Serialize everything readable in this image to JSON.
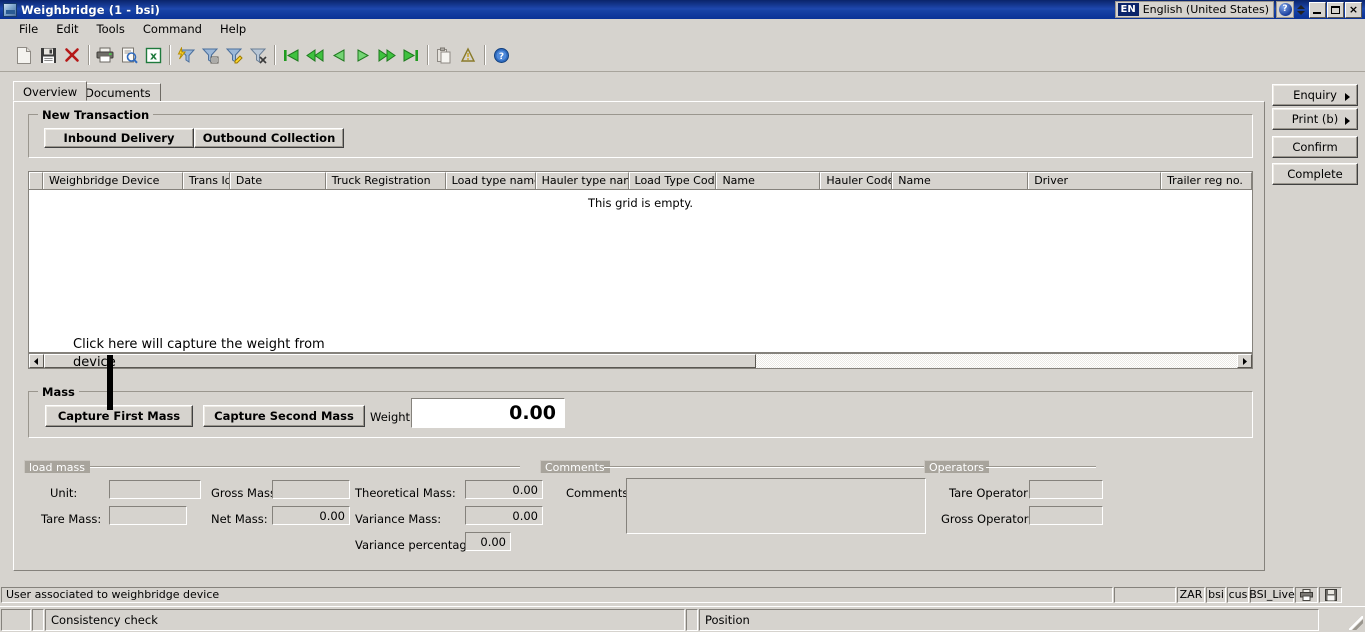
{
  "window": {
    "title": "Weighbridge (1 - bsi)",
    "icon": "application-icon",
    "language_code": "EN",
    "language_name": "English (United States)",
    "help_icon": "help-circle-icon",
    "minimize_label": "_",
    "maximize_label": "",
    "close_label": "×"
  },
  "menubar": {
    "items": [
      {
        "label": "File"
      },
      {
        "label": "Edit"
      },
      {
        "label": "Tools"
      },
      {
        "label": "Command"
      },
      {
        "label": "Help"
      }
    ]
  },
  "toolbar": {
    "items": [
      {
        "name": "new-document-icon",
        "type": "icon"
      },
      {
        "name": "save-icon",
        "type": "icon"
      },
      {
        "name": "delete-icon",
        "type": "icon"
      },
      {
        "name": "separator",
        "type": "sep"
      },
      {
        "name": "print-icon",
        "type": "icon"
      },
      {
        "name": "print-preview-icon",
        "type": "icon"
      },
      {
        "name": "export-excel-icon",
        "type": "icon"
      },
      {
        "name": "separator",
        "type": "sep"
      },
      {
        "name": "quick-filter-icon",
        "type": "icon"
      },
      {
        "name": "filter-by-selection-icon",
        "type": "icon"
      },
      {
        "name": "edit-filter-icon",
        "type": "icon"
      },
      {
        "name": "clear-filter-icon",
        "type": "icon"
      },
      {
        "name": "separator",
        "type": "sep"
      },
      {
        "name": "first-record-icon",
        "type": "icon"
      },
      {
        "name": "fast-previous-icon",
        "type": "icon"
      },
      {
        "name": "previous-record-icon",
        "type": "icon"
      },
      {
        "name": "next-record-icon",
        "type": "icon"
      },
      {
        "name": "fast-next-icon",
        "type": "icon"
      },
      {
        "name": "last-record-icon",
        "type": "icon"
      },
      {
        "name": "separator",
        "type": "sep"
      },
      {
        "name": "copy-icon",
        "type": "icon"
      },
      {
        "name": "alert-icon",
        "type": "icon"
      },
      {
        "name": "separator",
        "type": "sep"
      },
      {
        "name": "help-icon",
        "type": "icon"
      }
    ]
  },
  "tabs": [
    {
      "label": "Overview",
      "active": true
    },
    {
      "label": "Documents",
      "active": false
    }
  ],
  "new_transaction": {
    "group_label": "New Transaction",
    "inbound_label": "Inbound Delivery",
    "outbound_label": "Outbound Collection"
  },
  "grid": {
    "columns": [
      {
        "label": "Weighbridge Device",
        "width": 140
      },
      {
        "label": "Trans Id",
        "width": 47
      },
      {
        "label": "Date",
        "width": 96
      },
      {
        "label": "Truck Registration",
        "width": 120
      },
      {
        "label": "Load type name",
        "width": 90
      },
      {
        "label": "Hauler type name",
        "width": 93
      },
      {
        "label": "Load Type Code",
        "width": 88
      },
      {
        "label": "Name",
        "width": 104
      },
      {
        "label": "Hauler Code",
        "width": 72
      },
      {
        "label": "Name",
        "width": 136
      },
      {
        "label": "Driver",
        "width": 133
      },
      {
        "label": "Trailer reg no.",
        "width": 91
      }
    ],
    "empty_message": "This grid is empty.",
    "rows": []
  },
  "annotation": {
    "line1": "Click here will capture the weight from",
    "line2": "device"
  },
  "mass": {
    "group_label": "Mass",
    "capture_first_label": "Capture First Mass",
    "capture_second_label": "Capture Second Mass",
    "weight_label": "Weight:",
    "weight_value": "0.00"
  },
  "load_mass": {
    "panel_label": "load mass",
    "unit_label": "Unit:",
    "unit_value": "",
    "tare_mass_label": "Tare Mass:",
    "tare_mass_value": "",
    "gross_mass_label": "Gross Mass:",
    "gross_mass_value": "",
    "net_mass_label": "Net Mass:",
    "net_mass_value": "0.00",
    "theoretical_mass_label": "Theoretical Mass:",
    "theoretical_mass_value": "0.00",
    "variance_mass_label": "Variance Mass:",
    "variance_mass_value": "0.00",
    "variance_percentage_label": "Variance percentage:",
    "variance_percentage_value": "0.00"
  },
  "comments": {
    "panel_label": "Comments",
    "field_label": "Comments:",
    "value": ""
  },
  "operators": {
    "panel_label": "Operators",
    "tare_operator_label": "Tare Operator:",
    "tare_operator_value": "",
    "gross_operator_label": "Gross Operator:",
    "gross_operator_value": ""
  },
  "side_buttons": [
    {
      "label": "Enquiry",
      "has_arrow": true
    },
    {
      "label": "Print (b)",
      "has_arrow": true
    },
    {
      "label": "Confirm",
      "has_arrow": false
    },
    {
      "label": "Complete",
      "has_arrow": false
    }
  ],
  "status_bar": {
    "message": "User associated to weighbridge device",
    "currency": "ZAR",
    "company": "bsi",
    "module": "cus",
    "database": "BSI_Live",
    "printer_icon": "printer-icon",
    "save-icon": "disk-icon"
  },
  "bottom_bar": {
    "consistency_label": "Consistency check",
    "position_label": "Position"
  }
}
